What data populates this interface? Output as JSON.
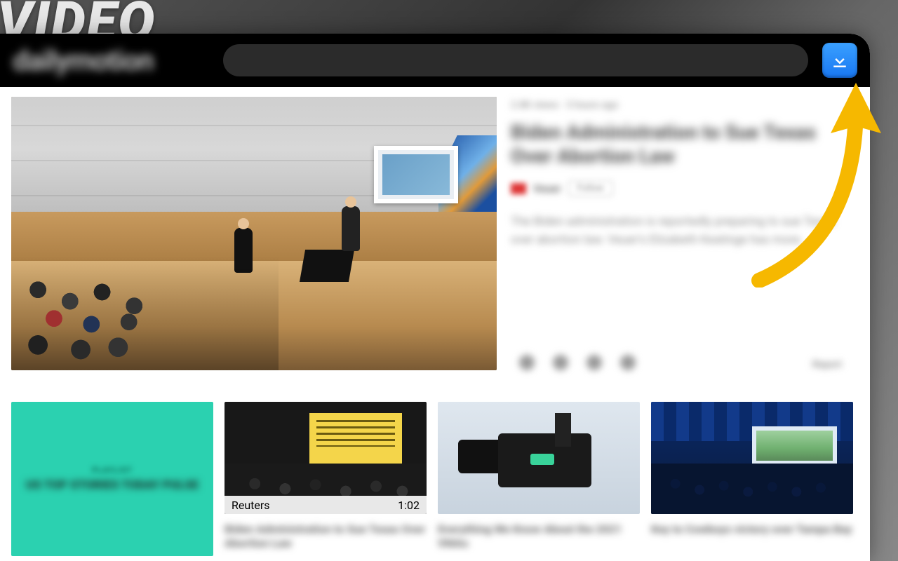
{
  "overlay": {
    "label": "VIDEO"
  },
  "header": {
    "brand": "dailymotion",
    "search_placeholder": "",
    "download_button_label": "Download"
  },
  "hero": {
    "meta": "2.8K views · 3 hours ago",
    "title": "Biden Administration to Sue Texas Over Abortion Law",
    "author_name": "Veuer",
    "follow_label": "Follow",
    "description": "The Biden administration is reportedly preparing to sue Texas over abortion law. Veuer's Elizabeth Keatinge has more.",
    "report_label": "Report"
  },
  "playlist": {
    "tag": "PLAYLIST",
    "title": "US TOP STORIES TODAY PULSE"
  },
  "cards": [
    {
      "title": "Biden Administration to Sue Texas Over Abortion Law",
      "source": "Reuters",
      "duration": "1:02"
    },
    {
      "title": "Everything We Know About the 2021 VMAs",
      "source": "",
      "duration": ""
    },
    {
      "title": "Key to Cowboys victory over Tampa Bay",
      "source": "",
      "duration": ""
    }
  ],
  "icons": {
    "download": "download-icon",
    "like": "like-icon",
    "add": "add-icon",
    "share": "share-icon",
    "embed": "embed-icon"
  },
  "colors": {
    "accent_blue": "#1877f2",
    "arrow_yellow": "#f6b800",
    "playlist_teal": "#2bd1b0"
  }
}
